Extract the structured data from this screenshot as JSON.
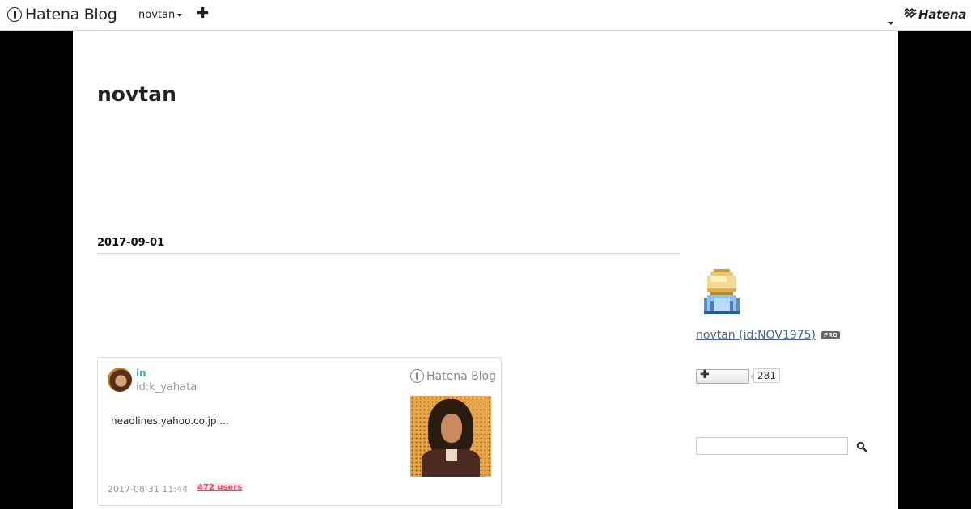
{
  "topbar": {
    "logo_text": "Hatena Blog",
    "blog_menu_label": "novtan",
    "add_label": "✚",
    "brand_text": "Hatena"
  },
  "blog": {
    "title": "novtan"
  },
  "archive": {
    "date": "2017-09-01"
  },
  "embed": {
    "title": "in",
    "author": "id:k_yahata",
    "brand": "Hatena Blog",
    "excerpt": "headlines.yahoo.co.jp ...",
    "date": "2017-08-31 11:44",
    "bookmark_users": "472 users"
  },
  "sidebar": {
    "profile_name": "novtan (id:NOV1975)",
    "badge": "PRO",
    "follow_icon": "plus-icon",
    "follower_count": "281",
    "search_placeholder": "",
    "search_icon": "magnifier-icon"
  },
  "colors": {
    "page_bg": "#000000",
    "content_bg": "#ffffff",
    "link": "#44668f",
    "embed_title": "#3ba4c9",
    "bookmark_users": "#ff4166"
  }
}
